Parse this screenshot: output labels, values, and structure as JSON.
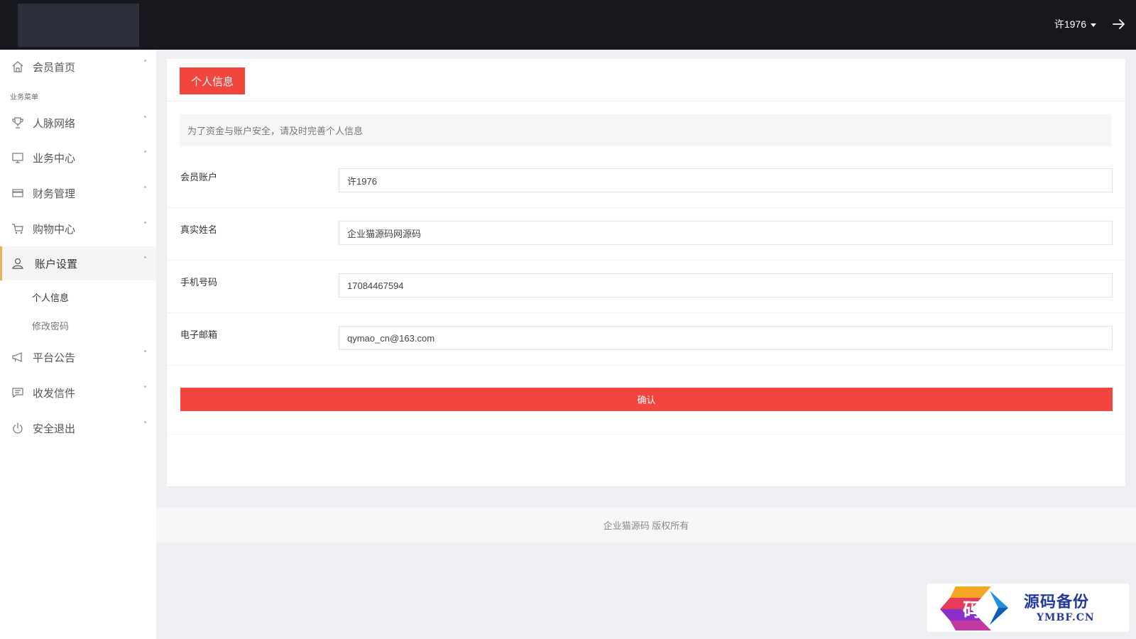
{
  "header": {
    "username": "许1976"
  },
  "sidebar": {
    "section_label": "业务菜单",
    "items": [
      {
        "label": "会员首页",
        "icon": "home-icon"
      },
      {
        "label": "人脉网络",
        "icon": "trophy-icon"
      },
      {
        "label": "业务中心",
        "icon": "monitor-icon"
      },
      {
        "label": "财务管理",
        "icon": "card-icon"
      },
      {
        "label": "购物中心",
        "icon": "cart-icon"
      },
      {
        "label": "账户设置",
        "icon": "user-icon",
        "active": true
      },
      {
        "label": "平台公告",
        "icon": "megaphone-icon"
      },
      {
        "label": "收发信件",
        "icon": "message-icon"
      },
      {
        "label": "安全退出",
        "icon": "power-icon"
      }
    ],
    "sub_items": [
      {
        "label": "个人信息",
        "current": true
      },
      {
        "label": "修改密码"
      }
    ]
  },
  "main": {
    "tab_label": "个人信息",
    "notice": "为了资金与账户安全，请及时完善个人信息",
    "fields": [
      {
        "label": "会员账户",
        "value": "许1976"
      },
      {
        "label": "真实姓名",
        "value": "企业猫源码网源码"
      },
      {
        "label": "手机号码",
        "value": "17084467594"
      },
      {
        "label": "电子邮箱",
        "value": "qymao_cn@163.com"
      }
    ],
    "submit_label": "确认"
  },
  "footer": {
    "copyright": "企业猫源码 版权所有"
  },
  "watermark": {
    "glyph": "码",
    "cn": "源码备份",
    "en": "YMBF.CN"
  },
  "colors": {
    "accent": "#f1453d",
    "topbar": "#17181d",
    "active_marker": "#e8b25a"
  }
}
